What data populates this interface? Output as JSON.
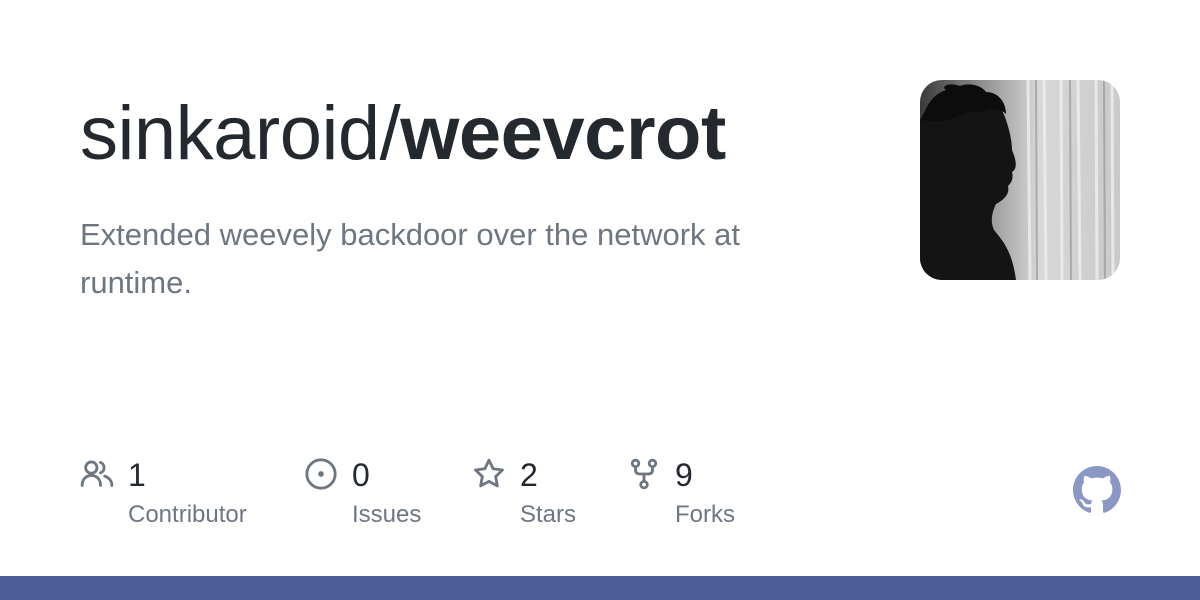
{
  "repo": {
    "owner": "sinkaroid/",
    "name": "weevcrot",
    "description": "Extended weevely backdoor over the network at runtime."
  },
  "stats": [
    {
      "icon": "people-icon",
      "count": "1",
      "label": "Contributor"
    },
    {
      "icon": "issue-opened-icon",
      "count": "0",
      "label": "Issues"
    },
    {
      "icon": "star-icon",
      "count": "2",
      "label": "Stars"
    },
    {
      "icon": "repo-forked-icon",
      "count": "9",
      "label": "Forks"
    }
  ],
  "colors": {
    "title": "#24292f",
    "muted": "#6e7781",
    "icon": "#6e7781",
    "logo": "#8b98c4",
    "bar": "#4c5c94"
  }
}
